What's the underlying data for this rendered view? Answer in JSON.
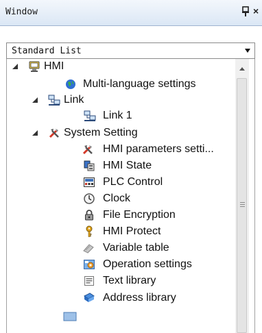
{
  "window": {
    "title": "Window",
    "close_glyph": "×"
  },
  "dropdown": {
    "value": "Standard List"
  },
  "tree": [
    {
      "label": "HMI",
      "icon": "hmi-icon",
      "expanded": true
    },
    {
      "label": "Multi-language settings",
      "icon": "globe-icon"
    },
    {
      "label": "Link",
      "icon": "network-icon",
      "expanded": true
    },
    {
      "label": "Link 1",
      "icon": "network-icon"
    },
    {
      "label": "System Setting",
      "icon": "tools-icon",
      "expanded": true
    },
    {
      "label": "HMI parameters setti...",
      "icon": "tools-icon"
    },
    {
      "label": "HMI State",
      "icon": "state-icon"
    },
    {
      "label": "PLC Control",
      "icon": "plc-icon"
    },
    {
      "label": "Clock",
      "icon": "clock-icon"
    },
    {
      "label": "File Encryption",
      "icon": "lock-icon"
    },
    {
      "label": "HMI Protect",
      "icon": "key-icon"
    },
    {
      "label": "Variable table",
      "icon": "variable-icon"
    },
    {
      "label": "Operation settings",
      "icon": "operation-icon"
    },
    {
      "label": "Text library",
      "icon": "text-icon"
    },
    {
      "label": "Address library",
      "icon": "address-icon"
    }
  ],
  "colors": {
    "titlebar_top": "#f3f7fc",
    "titlebar_bottom": "#dbe7f5",
    "text": "#111111"
  }
}
